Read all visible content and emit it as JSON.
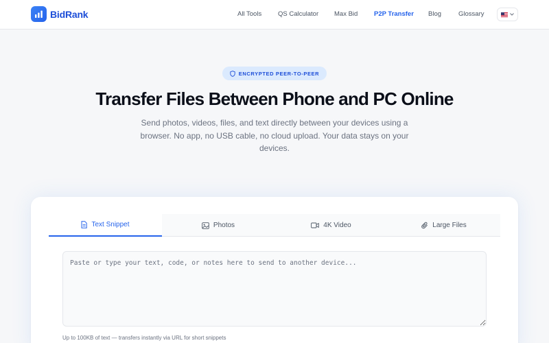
{
  "brand": {
    "name": "BidRank",
    "icon": "bar-chart-logo",
    "color": "#2563eb"
  },
  "nav": {
    "items": [
      {
        "label": "All Tools",
        "active": false
      },
      {
        "label": "QS Calculator",
        "active": false
      },
      {
        "label": "Max Bid",
        "active": false
      },
      {
        "label": "P2P Transfer",
        "active": true
      },
      {
        "label": "Blog",
        "active": false
      },
      {
        "label": "Glossary",
        "active": false
      }
    ],
    "language": {
      "flag": "us-flag-icon",
      "icon": "chevron-down-icon"
    }
  },
  "hero": {
    "badge": "ENCRYPTED PEER-TO-PEER",
    "badge_icon": "shield-icon",
    "title": "Transfer Files Between Phone and PC Online",
    "subtitle": "Send photos, videos, files, and text directly between your devices using a browser. No app, no USB cable, no cloud upload. Your data stays on your devices."
  },
  "transfer": {
    "tabs": [
      {
        "label": "Text Snippet",
        "icon": "document-icon",
        "active": true
      },
      {
        "label": "Photos",
        "icon": "image-icon",
        "active": false
      },
      {
        "label": "4K Video",
        "icon": "video-icon",
        "active": false
      },
      {
        "label": "Large Files",
        "icon": "paperclip-icon",
        "active": false
      }
    ],
    "input": {
      "value": "",
      "placeholder": "Paste or type your text, code, or notes here to send to another device..."
    },
    "hint": "Up to 100KB of text — transfers instantly via URL for short snippets"
  },
  "colors": {
    "accent": "#2563eb",
    "badge_bg": "#dbeafe",
    "page_bg": "#f6f7f9"
  }
}
